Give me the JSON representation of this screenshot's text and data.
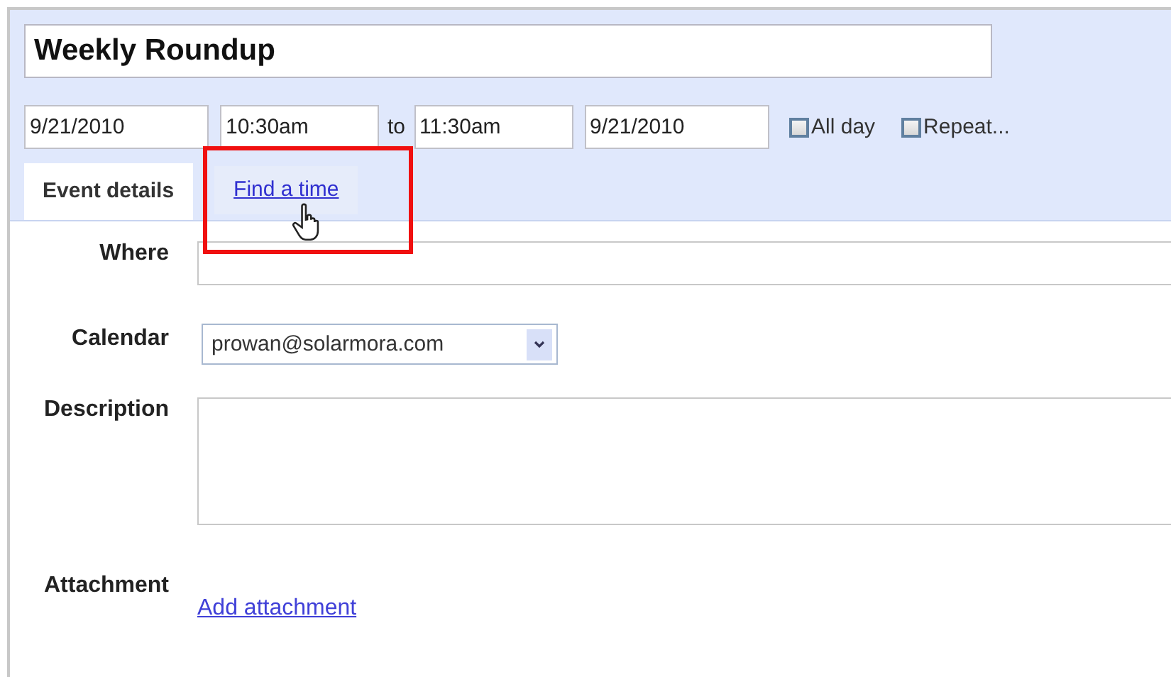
{
  "title": "Weekly Roundup",
  "when": {
    "start_date": "9/21/2010",
    "start_time": "10:30am",
    "separator": "to",
    "end_time": "11:30am",
    "end_date": "9/21/2010"
  },
  "options": [
    {
      "label": "All day",
      "checked": false
    },
    {
      "label": "Repeat...",
      "checked": false
    }
  ],
  "tabs": [
    {
      "label": "Event details",
      "selected": true
    },
    {
      "label": "Find a time",
      "selected": false,
      "highlighted": true
    }
  ],
  "fields": [
    {
      "kind": "text",
      "label": "Where"
    },
    {
      "kind": "select",
      "label": "Calendar",
      "value": "prowan@solarmora.com"
    },
    {
      "kind": "textarea",
      "label": "Description"
    },
    {
      "kind": "link",
      "label": "Attachment",
      "link": "Add attachment"
    }
  ]
}
